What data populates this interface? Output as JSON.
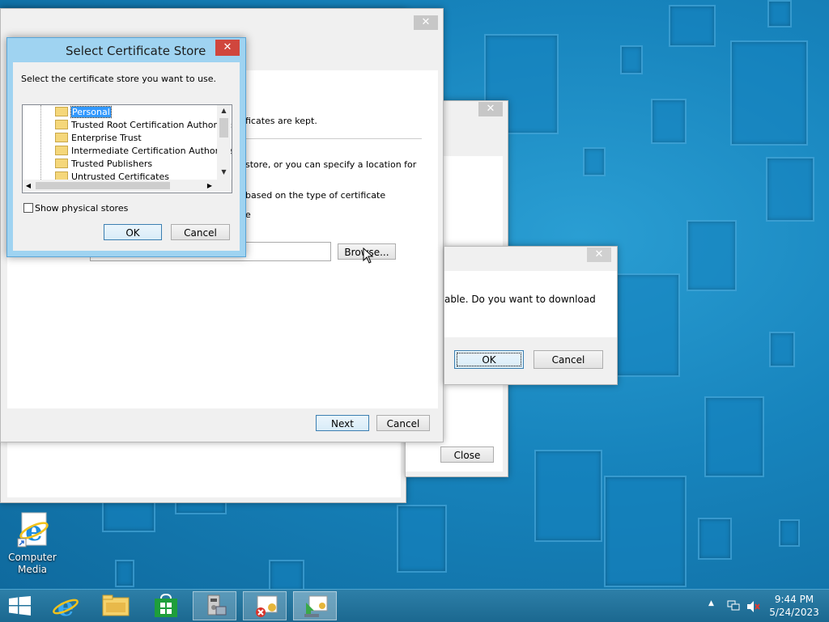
{
  "desktop": {
    "icon_label_line1": "Computer",
    "icon_label_line2": "Media"
  },
  "dialog_store": {
    "title": "Select Certificate Store",
    "instruction": "Select the certificate store you want to use.",
    "stores": [
      "Personal",
      "Trusted Root Certification Authorities",
      "Enterprise Trust",
      "Intermediate Certification Authorities",
      "Trusted Publishers",
      "Untrusted Certificates"
    ],
    "selected_store": "Personal",
    "show_physical_label": "Show physical stores",
    "ok": "OK",
    "cancel": "Cancel"
  },
  "wizard": {
    "text_fragment1": "ficates are kept.",
    "text_fragment2": "store, or you can specify a location for",
    "text_fragment3": "based on the type of certificate",
    "text_fragment4": "e",
    "browse": "Browse...",
    "next": "Next",
    "cancel": "Cancel"
  },
  "back_window": {
    "close": "Close"
  },
  "message_dialog": {
    "text": "able. Do you want to download",
    "ok": "OK",
    "cancel": "Cancel"
  },
  "taskbar": {
    "time": "9:44 PM",
    "date": "5/24/2023"
  },
  "colors": {
    "accent": "#3399ff",
    "close_red": "#d0463d",
    "taskbar": "#1b6890"
  }
}
